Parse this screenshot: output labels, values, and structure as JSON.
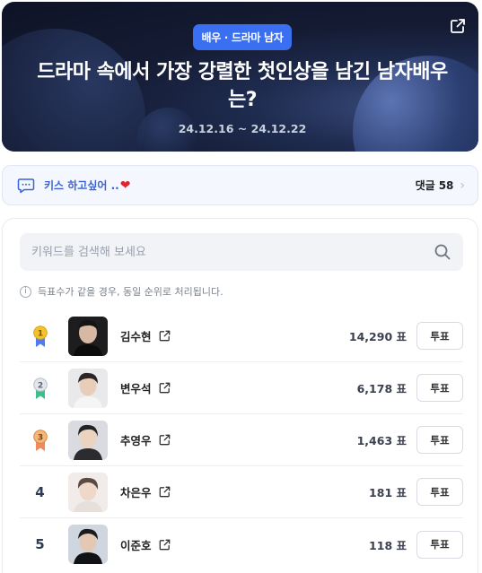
{
  "hero": {
    "badge": "배우 · 드라마 남자",
    "title": "드라마 속에서 가장 강렬한 첫인상을 남긴 남자배우는?",
    "date_range": "24.12.16 ~ 24.12.22",
    "share_icon": "share-icon"
  },
  "comment": {
    "text": "키스 하고싶어 ..",
    "emoji": "❤",
    "count_label": "댓글",
    "count": "58",
    "icon": "chat-icon"
  },
  "search": {
    "placeholder": "키워드를 검색해 보세요",
    "value": ""
  },
  "notice": {
    "text": "득표수가 같을 경우, 동일 순위로 처리됩니다."
  },
  "candidates": [
    {
      "rank": "1",
      "medal": "gold",
      "name": "김수현",
      "votes": "14,290 표",
      "vote_label": "투표"
    },
    {
      "rank": "2",
      "medal": "silver",
      "name": "변우석",
      "votes": "6,178 표",
      "vote_label": "투표"
    },
    {
      "rank": "3",
      "medal": "bronze",
      "name": "추영우",
      "votes": "1,463 표",
      "vote_label": "투표"
    },
    {
      "rank": "4",
      "medal": "",
      "name": "차은우",
      "votes": "181 표",
      "vote_label": "투표"
    },
    {
      "rank": "5",
      "medal": "",
      "name": "이준호",
      "votes": "118 표",
      "vote_label": "투표"
    }
  ],
  "colors": {
    "accent": "#3a6ff2",
    "comment_text": "#3a63d6",
    "gold": "#f2c230",
    "silver": "#c4cad3",
    "bronze": "#e9a35d",
    "ribbon_blue": "#4d7cf0",
    "ribbon_green": "#3dbf8a",
    "ribbon_orange": "#f08a5d"
  }
}
